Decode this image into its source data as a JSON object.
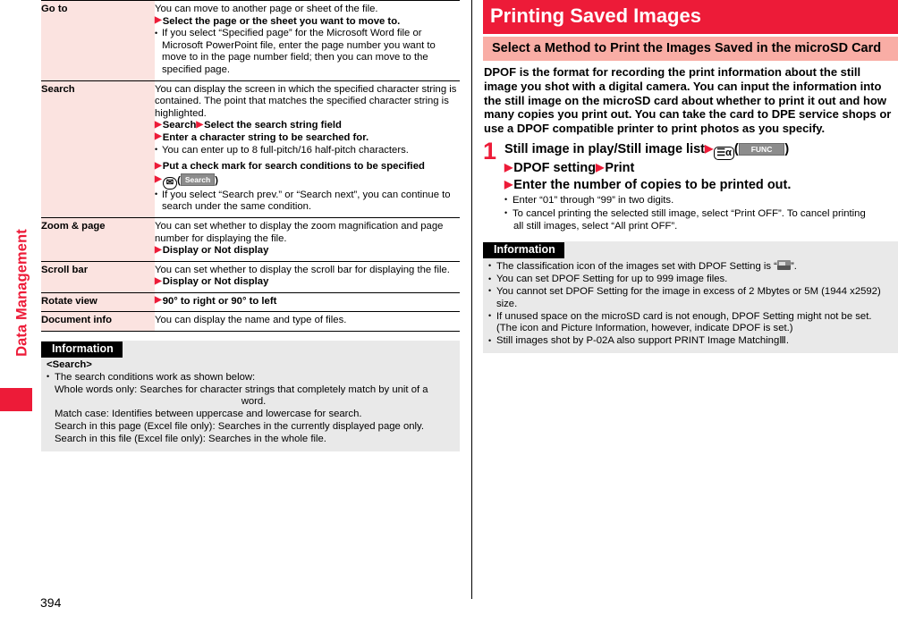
{
  "sidebar": {
    "chapter_label": "Data Management"
  },
  "page_number": "394",
  "left": {
    "table": {
      "rows": [
        {
          "key": "Go to",
          "intro": "You can move to another page or sheet of the file.",
          "action": "Select the page or the sheet you want to move to.",
          "note": "If you select “Specified page” for the Microsoft Word file or Microsoft PowerPoint file, enter the page number you want to move to in the page number field; then you can move to the specified page."
        },
        {
          "key": "Search",
          "intro": "You can display the screen in which the specified character string is contained. The point that matches the specified character string is highlighted.",
          "action1a": "Search",
          "action1b": "Select the search string field",
          "action2": "Enter a character string to be searched for.",
          "note1": "You can enter up to 8 full-pitch/16 half-pitch characters.",
          "action3": "Put a check mark for search conditions to be specified",
          "key_icon": "mail-key-icon",
          "soft_label": "Search",
          "note2": "If you select “Search prev.” or “Search next”, you can continue to search under the same condition."
        },
        {
          "key": "Zoom & page",
          "intro": "You can set whether to display the zoom magnification and page number for displaying the file.",
          "action": "Display or Not display"
        },
        {
          "key": "Scroll bar",
          "intro": "You can set whether to display the scroll bar for displaying the file.",
          "action": "Display or Not display"
        },
        {
          "key": "Rotate view",
          "action": "90° to right or 90° to left"
        },
        {
          "key": "Document info",
          "intro": "You can display the name and type of files."
        }
      ]
    },
    "information": {
      "title": "Information",
      "subject": "<Search>",
      "bullet": "The search conditions work as shown below:",
      "line1a": "Whole words only: Searches for character strings that completely match by unit of a",
      "line1b": "word.",
      "line2": "Match case: Identifies between uppercase and lowercase for search.",
      "line3": "Search in this page (Excel file only): Searches in the currently displayed page only.",
      "line4": "Search in this file (Excel file only): Searches in the whole file."
    }
  },
  "right": {
    "chapter_title": "Printing Saved Images",
    "section_title": "Select a Method to Print the Images Saved in the microSD Card",
    "lead": "DPOF is the format for recording the print information about the still image you shot with a digital camera. You can input the information into the still image on the microSD card about whether to print it out and how many copies you print out. You can take the card to DPE service shops or use a DPOF compatible printer to print photos as you specify.",
    "step": {
      "number": "1",
      "line1": "Still image in play/Still image list",
      "key_icon": "func-key-icon",
      "soft_label": "FUNC",
      "line2a": "DPOF setting",
      "line2b": "Print",
      "line3": "Enter the number of copies to be printed out.",
      "note1": "Enter “01” through “99” in two digits.",
      "note2a": "To cancel printing the selected still image, select “Print OFF”. To cancel printing",
      "note2b": "all still images, select “All print OFF”."
    },
    "information": {
      "title": "Information",
      "b1_pre": "The classification icon of the images set with DPOF Setting is “",
      "b1_icon": "dpof-classification-icon",
      "b1_post": "”.",
      "b2": "You can set DPOF Setting for up to 999 image files.",
      "b3a": "You cannot set DPOF Setting for the image in excess of 2 Mbytes or 5M (1944 x",
      "b3b": "2592) size.",
      "b4a": "If unused space on the microSD card is not enough, DPOF Setting might not be set.",
      "b4b": "(The icon and Picture Information, however, indicate DPOF is set.)",
      "b5_pre": "Still images shot by P-02A also support PRINT Image Matching",
      "b5_roman": "Ⅲ",
      "b5_post": "."
    }
  },
  "colors": {
    "brand_red": "#ED1B38",
    "pink_light": "#FBE3E0",
    "pink_mid": "#F9ADA5",
    "info_gray": "#E9E9E9"
  }
}
